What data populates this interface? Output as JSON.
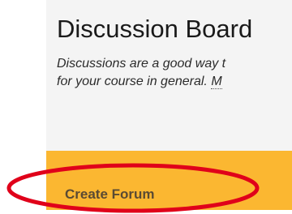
{
  "header": {
    "title": "Discussion Board"
  },
  "description": {
    "line1": "Discussions are a good way t",
    "line2_prefix": "for your course in general. ",
    "line2_link": "M"
  },
  "toolbar": {
    "create_forum_label": "Create Forum"
  },
  "colors": {
    "panel_bg": "#f4f4f4",
    "toolbar_bg": "#fbb731",
    "highlight_ring": "#e0001a"
  }
}
